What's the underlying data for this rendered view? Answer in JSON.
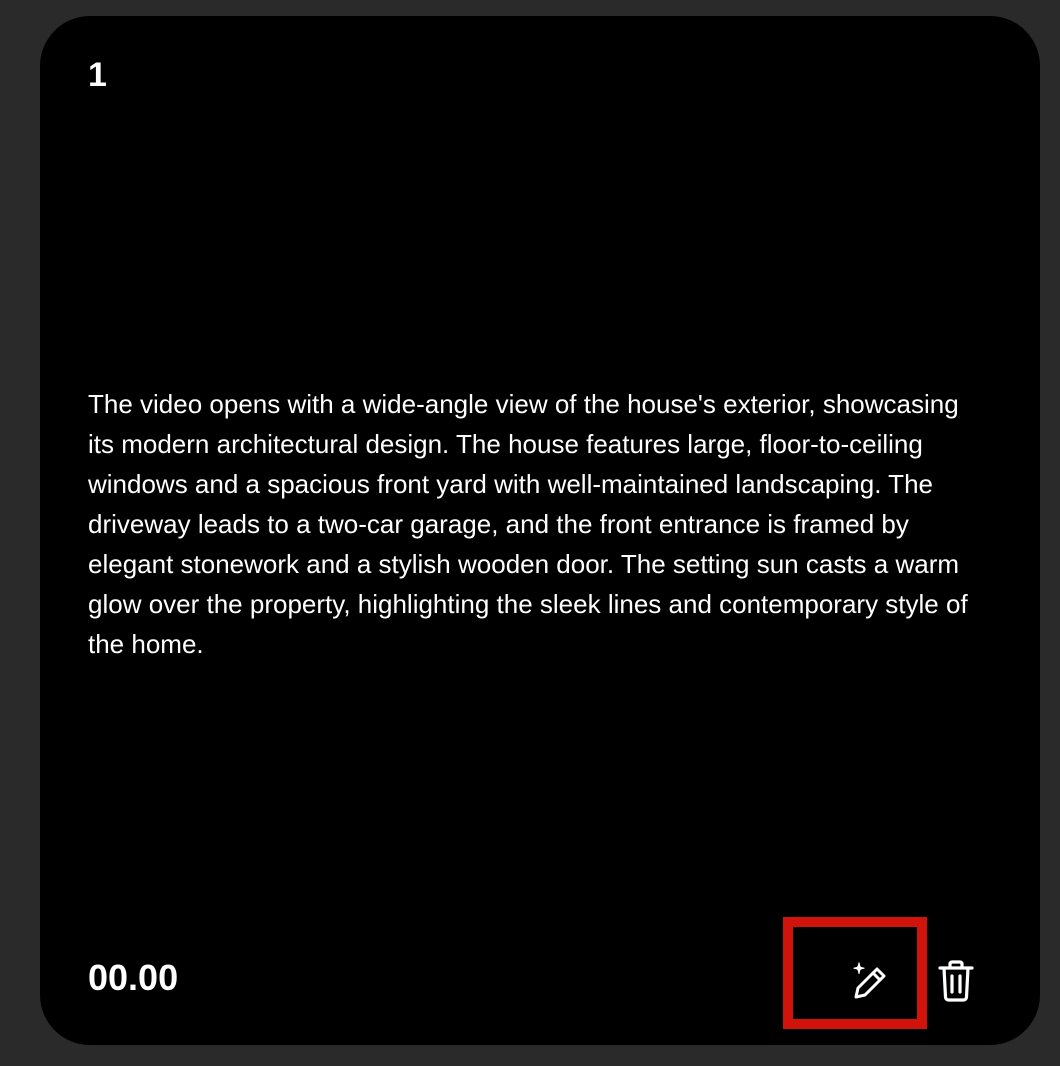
{
  "scene": {
    "number": "1",
    "description": "The video opens with a wide-angle view of the house's exterior, showcasing its modern architectural design. The house features large, floor-to-ceiling windows and a spacious front yard with well-maintained landscaping. The driveway leads to a two-car garage, and the front entrance is framed by elegant stonework and a stylish wooden door. The setting sun casts a warm glow over the property, highlighting the sleek lines and contemporary style of the home.",
    "timestamp": "00.00"
  },
  "actions": {
    "edit_icon": "magic-pencil-icon",
    "delete_icon": "trash-icon"
  },
  "colors": {
    "background": "#2a2a2a",
    "card": "#000000",
    "text": "#ffffff",
    "highlight": "#d0140c"
  }
}
